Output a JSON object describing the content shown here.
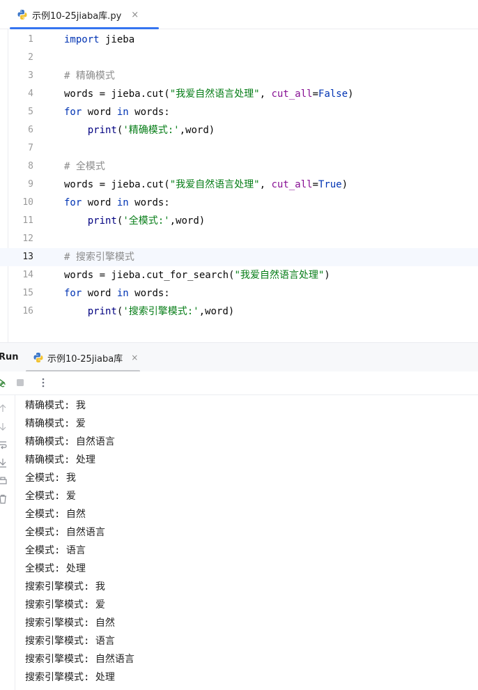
{
  "editor": {
    "tab_label": "示例10-25jiaba库.py",
    "tab_close": "×",
    "current_line": 13,
    "lines": [
      {
        "num": "1",
        "tokens": [
          {
            "t": "import",
            "c": "kw"
          },
          {
            "t": " jieba",
            "c": ""
          }
        ]
      },
      {
        "num": "2",
        "tokens": []
      },
      {
        "num": "3",
        "tokens": [
          {
            "t": "# 精确模式",
            "c": "cmt"
          }
        ]
      },
      {
        "num": "4",
        "tokens": [
          {
            "t": "words = jieba.cut(",
            "c": ""
          },
          {
            "t": "\"我爱自然语言处理\"",
            "c": "str"
          },
          {
            "t": ", ",
            "c": ""
          },
          {
            "t": "cut_all",
            "c": "param"
          },
          {
            "t": "=",
            "c": ""
          },
          {
            "t": "False",
            "c": "kw"
          },
          {
            "t": ")",
            "c": ""
          }
        ]
      },
      {
        "num": "5",
        "tokens": [
          {
            "t": "for",
            "c": "kw"
          },
          {
            "t": " word ",
            "c": ""
          },
          {
            "t": "in",
            "c": "kw"
          },
          {
            "t": " words:",
            "c": ""
          }
        ]
      },
      {
        "num": "6",
        "tokens": [
          {
            "t": "    ",
            "c": ""
          },
          {
            "t": "print",
            "c": "fn"
          },
          {
            "t": "(",
            "c": ""
          },
          {
            "t": "'精确模式:'",
            "c": "str"
          },
          {
            "t": ",word)",
            "c": ""
          }
        ]
      },
      {
        "num": "7",
        "tokens": []
      },
      {
        "num": "8",
        "tokens": [
          {
            "t": "# 全模式",
            "c": "cmt"
          }
        ]
      },
      {
        "num": "9",
        "tokens": [
          {
            "t": "words = jieba.cut(",
            "c": ""
          },
          {
            "t": "\"我爱自然语言处理\"",
            "c": "str"
          },
          {
            "t": ", ",
            "c": ""
          },
          {
            "t": "cut_all",
            "c": "param"
          },
          {
            "t": "=",
            "c": ""
          },
          {
            "t": "True",
            "c": "kw"
          },
          {
            "t": ")",
            "c": ""
          }
        ]
      },
      {
        "num": "10",
        "tokens": [
          {
            "t": "for",
            "c": "kw"
          },
          {
            "t": " word ",
            "c": ""
          },
          {
            "t": "in",
            "c": "kw"
          },
          {
            "t": " words:",
            "c": ""
          }
        ]
      },
      {
        "num": "11",
        "tokens": [
          {
            "t": "    ",
            "c": ""
          },
          {
            "t": "print",
            "c": "fn"
          },
          {
            "t": "(",
            "c": ""
          },
          {
            "t": "'全模式:'",
            "c": "str"
          },
          {
            "t": ",word)",
            "c": ""
          }
        ]
      },
      {
        "num": "12",
        "tokens": []
      },
      {
        "num": "13",
        "tokens": [
          {
            "t": "# 搜索引擎模式",
            "c": "cmt"
          }
        ]
      },
      {
        "num": "14",
        "tokens": [
          {
            "t": "words = jieba.cut_for_search(",
            "c": ""
          },
          {
            "t": "\"我爱自然语言处理\"",
            "c": "str"
          },
          {
            "t": ")",
            "c": ""
          }
        ]
      },
      {
        "num": "15",
        "tokens": [
          {
            "t": "for",
            "c": "kw"
          },
          {
            "t": " word ",
            "c": ""
          },
          {
            "t": "in",
            "c": "kw"
          },
          {
            "t": " words:",
            "c": ""
          }
        ]
      },
      {
        "num": "16",
        "tokens": [
          {
            "t": "    ",
            "c": ""
          },
          {
            "t": "print",
            "c": "fn"
          },
          {
            "t": "(",
            "c": ""
          },
          {
            "t": "'搜索引擎模式:'",
            "c": "str"
          },
          {
            "t": ",word)",
            "c": ""
          }
        ]
      }
    ]
  },
  "run": {
    "title": "Run",
    "tab_label": "示例10-25jiaba库",
    "tab_close": "×",
    "output": [
      "精确模式: 我",
      "精确模式: 爱",
      "精确模式: 自然语言",
      "精确模式: 处理",
      "全模式: 我",
      "全模式: 爱",
      "全模式: 自然",
      "全模式: 自然语言",
      "全模式: 语言",
      "全模式: 处理",
      "搜索引擎模式: 我",
      "搜索引擎模式: 爱",
      "搜索引擎模式: 自然",
      "搜索引擎模式: 语言",
      "搜索引擎模式: 自然语言",
      "搜索引擎模式: 处理"
    ]
  },
  "icons": {
    "editor_tab": "python-file-icon",
    "run_tab": "python-file-icon",
    "toolbar": [
      "rerun-icon",
      "stop-icon",
      "more-options-icon"
    ],
    "side": [
      "scroll-up-icon",
      "scroll-down-icon",
      "soft-wrap-icon",
      "scroll-to-end-icon",
      "print-icon",
      "trash-icon"
    ]
  },
  "colors": {
    "accent": "#3574f0",
    "keyword": "#0033b3",
    "string": "#067d17",
    "comment": "#8c8c8c",
    "parameter": "#871094",
    "builtin": "#000080",
    "current_line_bg": "#f5f8fe",
    "run_icon": "#3b8a3e"
  }
}
